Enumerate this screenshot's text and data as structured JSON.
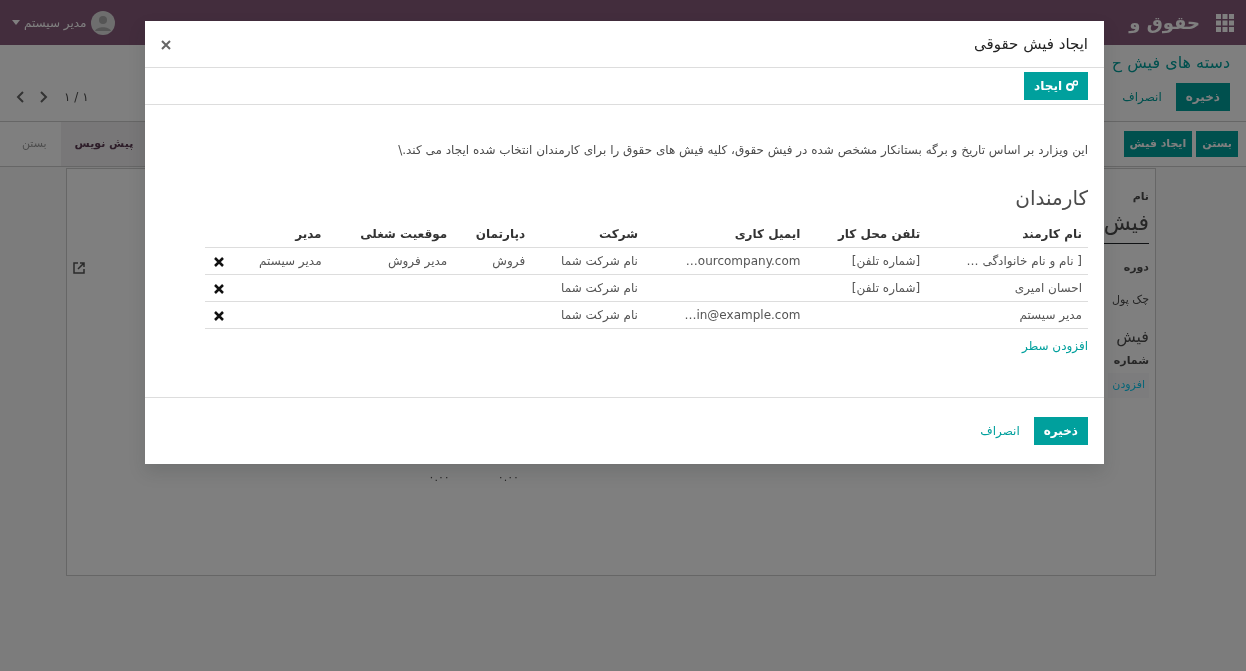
{
  "navbar": {
    "app_title": "حقوق و",
    "user": "مدیر سیستم"
  },
  "control_panel": {
    "breadcrumb": "دسته های فیش ح",
    "buttons": [
      {
        "label": "ذخیره",
        "kind": "primary"
      },
      {
        "label": "انصراف",
        "kind": "link"
      }
    ],
    "pager": "۱ / ۱"
  },
  "status_bar": {
    "buttons": [
      "بستن",
      "ایجاد فیش"
    ],
    "stages": [
      {
        "label": "پیش نویس",
        "selected": true
      },
      {
        "label": "بستن",
        "selected": false
      }
    ]
  },
  "sheet": {
    "name_label": "نام",
    "name_value": "فیش",
    "period_label": "دوره",
    "check_label": "چک پول",
    "section_title": "فیش",
    "ref_label": "شماره",
    "add_line": "افزودن",
    "totals": [
      "۰.۰۰",
      "۰.۰۰"
    ]
  },
  "modal": {
    "title": "ایجاد فیش حقوقی",
    "generate_button": "ایجاد",
    "description": "این ویزارد بر اساس تاریخ و برگه بستانکار مشخص شده در فیش حقوق، کلیه فیش های حقوق را برای کارمندان انتخاب شده ایجاد می کند.\\",
    "section_title": "کارمندان",
    "table": {
      "columns": [
        "نام کارمند",
        "تلفن محل کار",
        "ایمیل کاری",
        "شرکت",
        "دپارتمان",
        "موقعیت شغلی",
        "مدیر"
      ],
      "rows": [
        [
          "[ نام و نام خانوادگی …",
          "[شماره تلفن]",
          "…ourcompany.com",
          "نام شرکت شما",
          "فروش",
          "مدیر فروش",
          "مدیر سیستم"
        ],
        [
          "احسان امیری",
          "[شماره تلفن]",
          "",
          "نام شرکت شما",
          "",
          "",
          ""
        ],
        [
          "مدیر سیستم",
          "",
          "…in@example.com",
          "نام شرکت شما",
          "",
          "",
          ""
        ]
      ]
    },
    "add_line": "افزودن سطر",
    "footer_buttons": [
      {
        "label": "ذخیره",
        "kind": "primary"
      },
      {
        "label": "انصراف",
        "kind": "link"
      }
    ]
  }
}
